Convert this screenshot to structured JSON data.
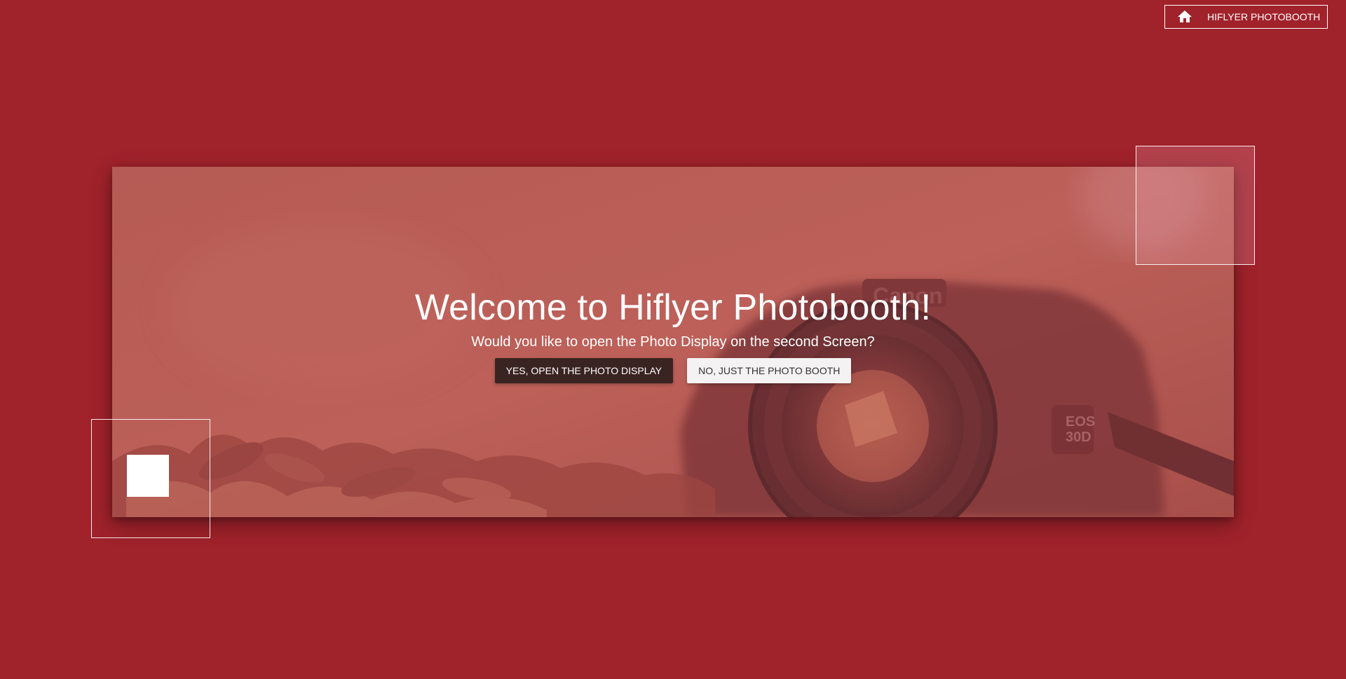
{
  "header": {
    "home_icon": "home-icon",
    "home_label": "HIFLYER PHOTOBOOTH"
  },
  "hero": {
    "title": "Welcome to Hiflyer Photobooth!",
    "subtitle": "Would you like to open the Photo Display on the second Screen?",
    "yes_label": "YES, OPEN THE PHOTO DISPLAY",
    "no_label": "NO, JUST THE PHOTO BOOTH",
    "camera_brand": "Canon",
    "camera_model_line1": "EOS",
    "camera_model_line2": "30D"
  },
  "colors": {
    "background": "#a0222b",
    "primary_button": "#3a2422",
    "secondary_button": "#f4f2f2",
    "text": "#ffffff"
  }
}
